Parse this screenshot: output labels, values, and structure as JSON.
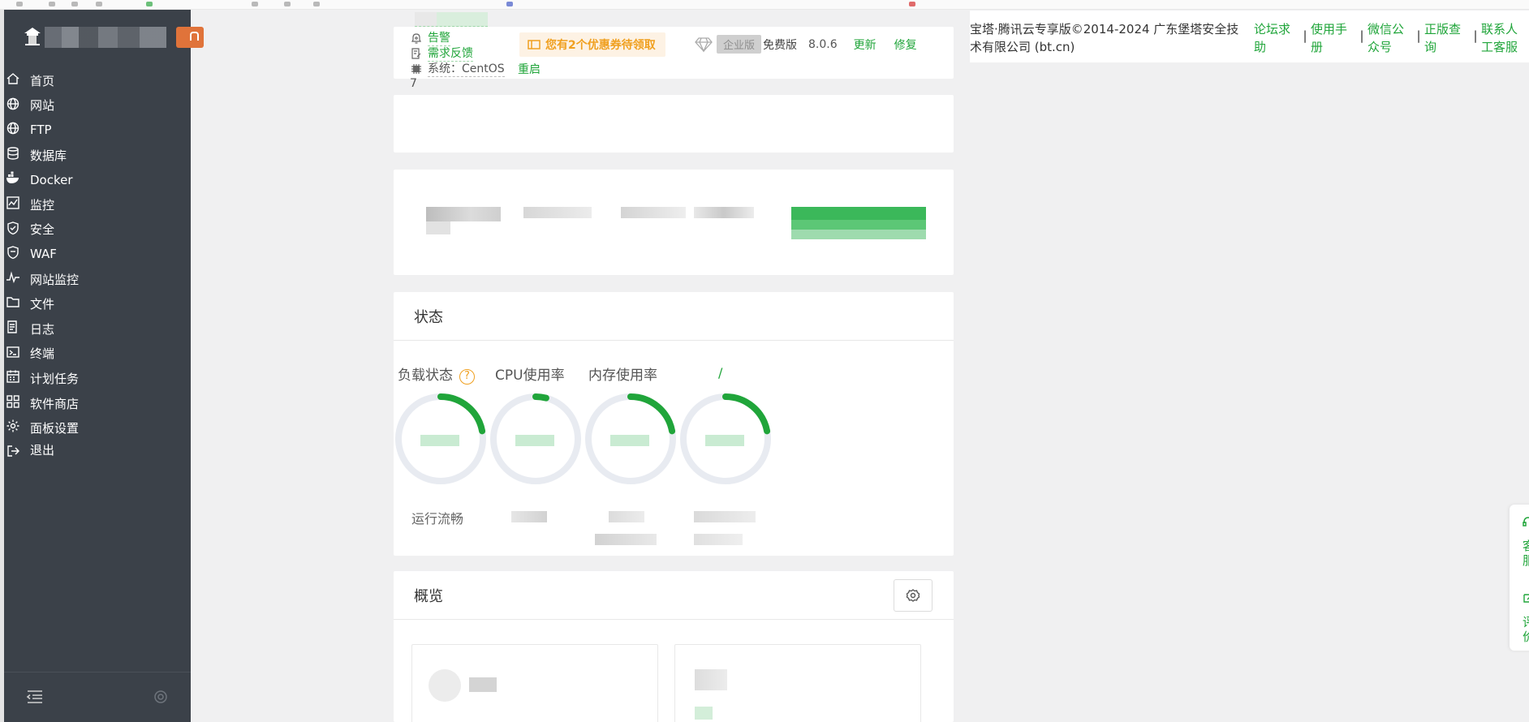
{
  "sidebar": {
    "menu": [
      {
        "label": "首页",
        "icon": "home-icon"
      },
      {
        "label": "网站",
        "icon": "globe-icon"
      },
      {
        "label": "FTP",
        "icon": "globe-icon"
      },
      {
        "label": "数据库",
        "icon": "database-icon"
      },
      {
        "label": "Docker",
        "icon": "docker-icon"
      },
      {
        "label": "监控",
        "icon": "monitor-chart-icon"
      },
      {
        "label": "安全",
        "icon": "shield-check-icon"
      },
      {
        "label": "WAF",
        "icon": "shield-icon"
      },
      {
        "label": "网站监控",
        "icon": "pulse-icon"
      },
      {
        "label": "文件",
        "icon": "folder-icon"
      },
      {
        "label": "日志",
        "icon": "log-file-icon"
      },
      {
        "label": "终端",
        "icon": "terminal-icon"
      },
      {
        "label": "计划任务",
        "icon": "calendar-icon"
      },
      {
        "label": "软件商店",
        "icon": "grid-icon"
      },
      {
        "label": "面板设置",
        "icon": "gear-icon"
      },
      {
        "label": "退出",
        "icon": "logout-icon"
      }
    ],
    "footer": {
      "collapse_icon": "collapse-menu-icon",
      "settings_icon": "gear-icon"
    },
    "colors": {
      "background": "#3b4149",
      "text": "#ffffff"
    }
  },
  "topbar": {
    "alert": "告警",
    "feedback": "需求反馈",
    "system": "系统：CentOS",
    "system_suffix": "7",
    "coupon": "您有2个优惠券待领取",
    "restart": "重启",
    "enterprise": "企业版",
    "free": "免费版",
    "version": "8.0.6",
    "update": "更新",
    "repair": "修复"
  },
  "status": {
    "title": "状态",
    "load": "负载状态",
    "help": "?",
    "cpu": "CPU使用率",
    "memory": "内存使用率",
    "disk": "/",
    "running": "运行流畅",
    "gauges": [
      {
        "name": "load",
        "level": 0.22
      },
      {
        "name": "cpu",
        "level": 0.04
      },
      {
        "name": "memory",
        "level": 0.22
      },
      {
        "name": "disk",
        "level": 0.22
      }
    ]
  },
  "overview": {
    "title": "概览",
    "settings_icon": "gear-icon"
  },
  "notice": {
    "copyright": "宝塔·腾讯云专享版©2014-2024 广东堡塔安全技术有限公司 (bt.cn)",
    "links": [
      "论坛求助",
      "使用手册",
      "微信公众号",
      "正版查询",
      "联系人工客服"
    ]
  },
  "floatbar": {
    "service": "客服",
    "feedback": "评价"
  },
  "colors": {
    "accent": "#20a53a",
    "warning": "#f0a020",
    "page_bg": "#f0f0f1"
  }
}
